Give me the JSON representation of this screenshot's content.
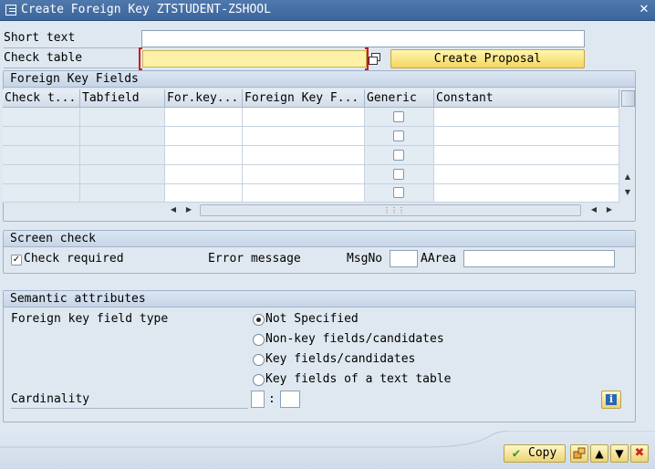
{
  "window": {
    "title": "Create Foreign Key ZTSTUDENT-ZSHOOL",
    "close_icon": "close-icon"
  },
  "header_fields": {
    "short_text_label": "Short text",
    "short_text_value": "",
    "check_table_label": "Check table",
    "check_table_value": "",
    "create_proposal_label": "Create Proposal"
  },
  "fk_fields": {
    "group_title": "Foreign Key Fields",
    "columns": [
      "Check t...",
      "Tabfield",
      "For.key...",
      "Foreign Key F...",
      "Generic",
      "Constant"
    ],
    "rows": [
      {
        "check_table": "",
        "tabfield": "",
        "for_key_table": "",
        "foreign_key_field": "",
        "generic": false,
        "constant": ""
      },
      {
        "check_table": "",
        "tabfield": "",
        "for_key_table": "",
        "foreign_key_field": "",
        "generic": false,
        "constant": ""
      },
      {
        "check_table": "",
        "tabfield": "",
        "for_key_table": "",
        "foreign_key_field": "",
        "generic": false,
        "constant": ""
      },
      {
        "check_table": "",
        "tabfield": "",
        "for_key_table": "",
        "foreign_key_field": "",
        "generic": false,
        "constant": ""
      },
      {
        "check_table": "",
        "tabfield": "",
        "for_key_table": "",
        "foreign_key_field": "",
        "generic": false,
        "constant": ""
      }
    ]
  },
  "screen_check": {
    "group_title": "Screen check",
    "check_required_label": "Check required",
    "check_required_checked": true,
    "error_message_label": "Error message",
    "msgno_label": "MsgNo",
    "msgno_value": "",
    "aarea_label": "AArea",
    "aarea_value": ""
  },
  "semantic": {
    "group_title": "Semantic attributes",
    "fk_field_type_label": "Foreign key field type",
    "options": [
      {
        "label": "Not Specified",
        "selected": true
      },
      {
        "label": "Non-key fields/candidates",
        "selected": false
      },
      {
        "label": "Key fields/candidates",
        "selected": false
      },
      {
        "label": "Key fields of a text table",
        "selected": false
      }
    ],
    "cardinality_label": "Cardinality",
    "cardinality_left": "",
    "cardinality_sep": ":",
    "cardinality_right": "",
    "info_icon": "i"
  },
  "footer": {
    "copy_label": "Copy",
    "colors": {
      "copy_check": "#2e9a2a",
      "cancel": "#cc2a1a"
    }
  }
}
